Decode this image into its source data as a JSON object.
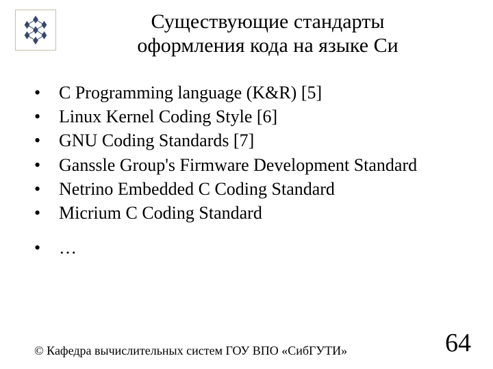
{
  "title_line1": "Существующие стандарты",
  "title_line2": "оформления кода на языке Си",
  "bullets": {
    "b0": "C Programming language (K&R) [5]",
    "b1": "Linux Kernel Coding Style [6]",
    "b2": "GNU Coding Standards [7]",
    "b3": "Ganssle Group's Firmware Development Standard",
    "b4": "Netrino Embedded C Coding Standard",
    "b5": "Micrium C Coding Standard",
    "b6": "…"
  },
  "footer": {
    "copyright": "© Кафедра вычислительных систем ГОУ ВПО «СибГУТИ»",
    "page": "64"
  }
}
